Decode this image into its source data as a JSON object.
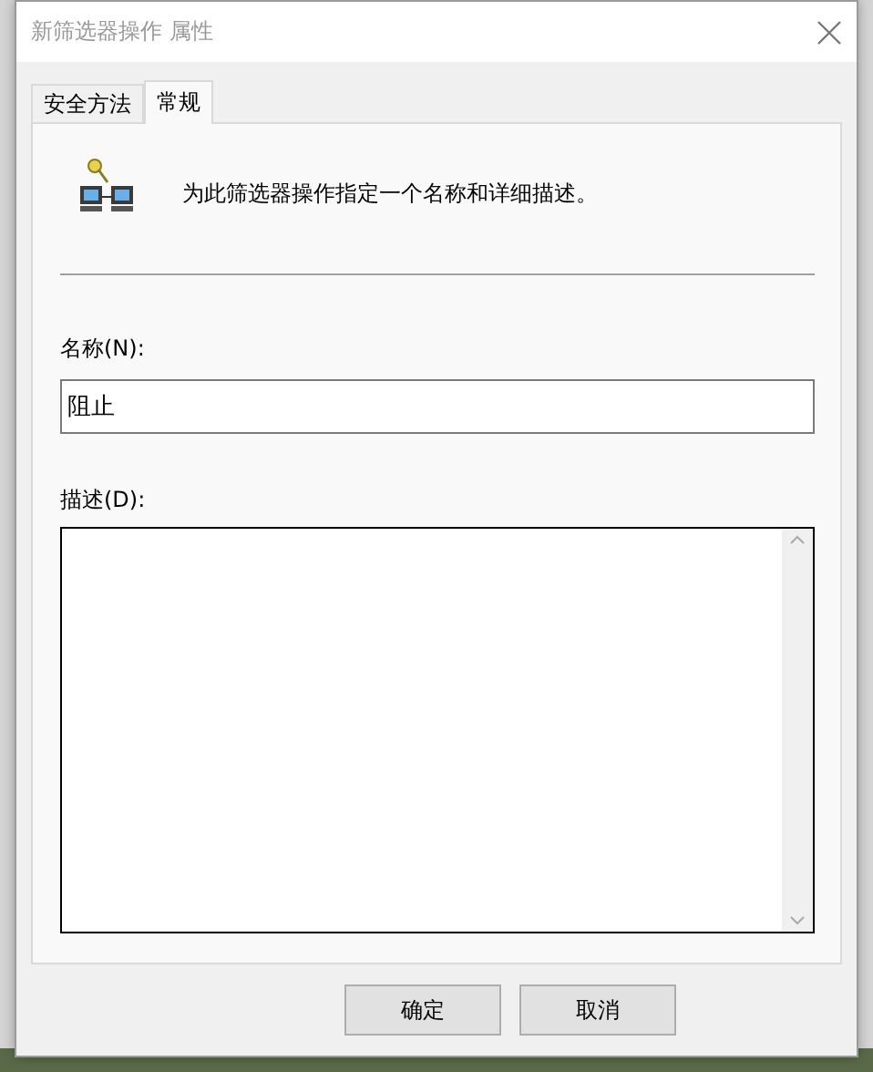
{
  "window": {
    "title": "新筛选器操作 属性"
  },
  "tabs": [
    {
      "label": "安全方法",
      "selected": false
    },
    {
      "label": "常规",
      "selected": true
    }
  ],
  "header": {
    "text": "为此筛选器操作指定一个名称和详细描述。"
  },
  "name_field": {
    "label": "名称(N):",
    "value": "阻止"
  },
  "description_field": {
    "label": "描述(D):"
  },
  "buttons": [
    {
      "label": "确定",
      "disabled": false
    },
    {
      "label": "取消",
      "disabled": false
    }
  ]
}
